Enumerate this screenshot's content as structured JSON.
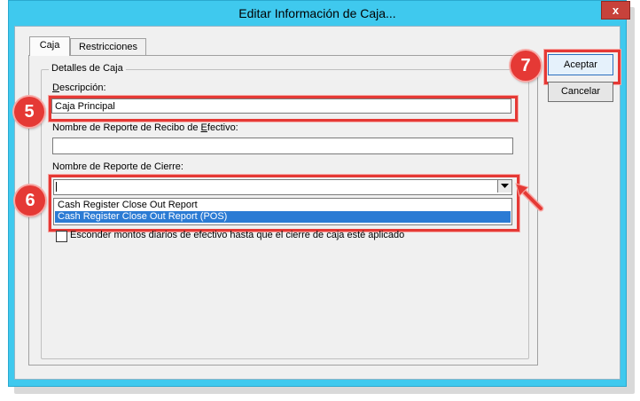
{
  "window": {
    "title": "Editar Información de Caja...",
    "close_glyph": "x"
  },
  "tabs": [
    {
      "label": "Caja",
      "active": true
    },
    {
      "label": "Restricciones",
      "active": false
    }
  ],
  "group": {
    "label": "Detalles de Caja"
  },
  "form": {
    "description_label": "Descripción:",
    "description_value": "Caja Principal",
    "receipt_report_label": "Nombre de Reporte de Recibo de Efectivo:",
    "receipt_report_value": "",
    "close_report_label": "Nombre de Reporte de Cierre:",
    "close_report_value": "",
    "close_report_options": [
      "Cash Register Close Out Report",
      "Cash Register Close Out Report (POS)"
    ],
    "highlighted_option_index": 1,
    "hide_amounts_label": "Esconder montos diarios de efectivo hasta que el cierre de caja esté aplicado",
    "hide_amounts_checked": false
  },
  "buttons": {
    "ok_label": "Aceptar",
    "cancel_label": "Cancelar"
  },
  "callouts": {
    "step5": "5",
    "step6": "6",
    "step7": "7"
  },
  "colors": {
    "titlebar": "#3fc9ee",
    "close_button": "#c7423b",
    "highlight": "#e53935",
    "selection": "#2b7bd4"
  },
  "icons": {
    "close": "close-icon",
    "dropdown": "chevron-down-icon",
    "pointer": "arrow-icon"
  }
}
